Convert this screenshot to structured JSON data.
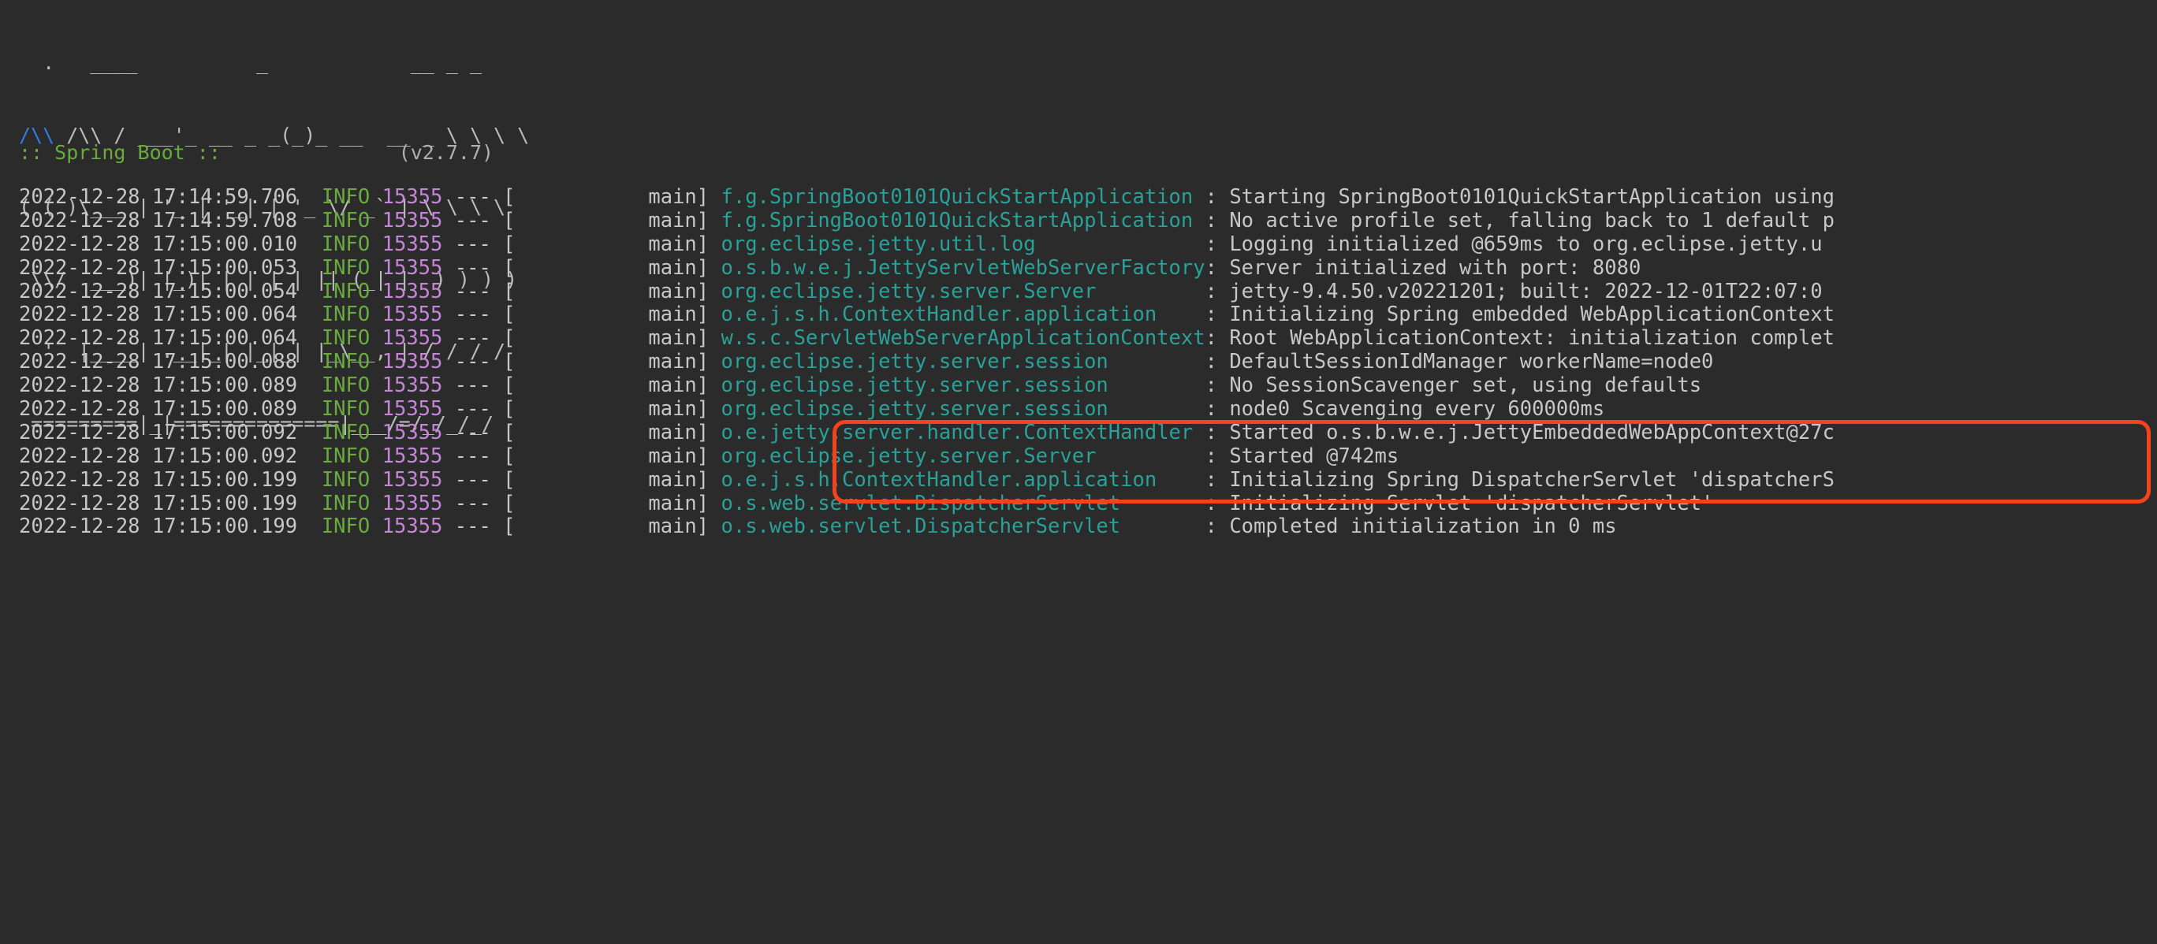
{
  "terminal": {
    "background_color": "#2b2b2b",
    "foreground_color": "#c7c7c7"
  },
  "banner": {
    "rows": [
      "  .   ____          _            __ _ _",
      " /\\\\ / ___'_ __ _ _(_)_ __  __ _ \\ \\ \\ \\",
      "( ( )\\___ | '_ | '_| | '_ \\/ _` | \\ \\ \\ \\",
      " \\\\/  ___)| |_)| | | | | || (_| |  ) ) ) )",
      "  '  |____| .__|_| |_|_| |_\\__, | / / / /",
      " =========|_|==============|___/=/_/_/_/"
    ],
    "blue_glyph": "/\\\\",
    "blue_color": "#2f7fe0",
    "framework_label": ":: Spring Boot ::",
    "framework_label_color": "#6aab3f",
    "version": "(v2.7.7)",
    "version_spacer": "               "
  },
  "annotation": {
    "type": "rectangle-highlight",
    "color": "#f4431c",
    "border_width_px": 5,
    "corner_radius_px": 16,
    "covers_line_indexes": [
      2,
      3,
      4
    ],
    "covers_loggers": [
      "org.eclipse.jetty.util.log",
      "o.s.b.w.e.j.JettyServletWebServerFactory",
      "org.eclipse.jetty.server.Server"
    ]
  },
  "log": {
    "level_label": "INFO",
    "pid": "15355",
    "separator": "---",
    "thread": "main",
    "message_separator": ":",
    "lines": [
      {
        "timestamp": "2022-12-28 17:14:59.706",
        "level": "INFO",
        "pid": "15355",
        "thread": "main",
        "logger": "f.g.SpringBoot0101QuickStartApplication",
        "message": "Starting SpringBoot0101QuickStartApplication using"
      },
      {
        "timestamp": "2022-12-28 17:14:59.708",
        "level": "INFO",
        "pid": "15355",
        "thread": "main",
        "logger": "f.g.SpringBoot0101QuickStartApplication",
        "message": "No active profile set, falling back to 1 default p"
      },
      {
        "timestamp": "2022-12-28 17:15:00.010",
        "level": "INFO",
        "pid": "15355",
        "thread": "main",
        "logger": "org.eclipse.jetty.util.log",
        "message": "Logging initialized @659ms to org.eclipse.jetty.u"
      },
      {
        "timestamp": "2022-12-28 17:15:00.053",
        "level": "INFO",
        "pid": "15355",
        "thread": "main",
        "logger": "o.s.b.w.e.j.JettyServletWebServerFactory",
        "message": "Server initialized with port: 8080"
      },
      {
        "timestamp": "2022-12-28 17:15:00.054",
        "level": "INFO",
        "pid": "15355",
        "thread": "main",
        "logger": "org.eclipse.jetty.server.Server",
        "message": "jetty-9.4.50.v20221201; built: 2022-12-01T22:07:0"
      },
      {
        "timestamp": "2022-12-28 17:15:00.064",
        "level": "INFO",
        "pid": "15355",
        "thread": "main",
        "logger": "o.e.j.s.h.ContextHandler.application",
        "message": "Initializing Spring embedded WebApplicationContext"
      },
      {
        "timestamp": "2022-12-28 17:15:00.064",
        "level": "INFO",
        "pid": "15355",
        "thread": "main",
        "logger": "w.s.c.ServletWebServerApplicationContext",
        "message": "Root WebApplicationContext: initialization complet"
      },
      {
        "timestamp": "2022-12-28 17:15:00.088",
        "level": "INFO",
        "pid": "15355",
        "thread": "main",
        "logger": "org.eclipse.jetty.server.session",
        "message": "DefaultSessionIdManager workerName=node0"
      },
      {
        "timestamp": "2022-12-28 17:15:00.089",
        "level": "INFO",
        "pid": "15355",
        "thread": "main",
        "logger": "org.eclipse.jetty.server.session",
        "message": "No SessionScavenger set, using defaults"
      },
      {
        "timestamp": "2022-12-28 17:15:00.089",
        "level": "INFO",
        "pid": "15355",
        "thread": "main",
        "logger": "org.eclipse.jetty.server.session",
        "message": "node0 Scavenging every 600000ms"
      },
      {
        "timestamp": "2022-12-28 17:15:00.092",
        "level": "INFO",
        "pid": "15355",
        "thread": "main",
        "logger": "o.e.jetty.server.handler.ContextHandler",
        "message": "Started o.s.b.w.e.j.JettyEmbeddedWebAppContext@27c"
      },
      {
        "timestamp": "2022-12-28 17:15:00.092",
        "level": "INFO",
        "pid": "15355",
        "thread": "main",
        "logger": "org.eclipse.jetty.server.Server",
        "message": "Started @742ms"
      },
      {
        "timestamp": "2022-12-28 17:15:00.199",
        "level": "INFO",
        "pid": "15355",
        "thread": "main",
        "logger": "o.e.j.s.h.ContextHandler.application",
        "message": "Initializing Spring DispatcherServlet 'dispatcherS"
      },
      {
        "timestamp": "2022-12-28 17:15:00.199",
        "level": "INFO",
        "pid": "15355",
        "thread": "main",
        "logger": "o.s.web.servlet.DispatcherServlet",
        "message": "Initializing Servlet 'dispatcherServlet'"
      },
      {
        "timestamp": "2022-12-28 17:15:00.199",
        "level": "INFO",
        "pid": "15355",
        "thread": "main",
        "logger": "o.s.web.servlet.DispatcherServlet",
        "message": "Completed initialization in 0 ms"
      }
    ]
  }
}
